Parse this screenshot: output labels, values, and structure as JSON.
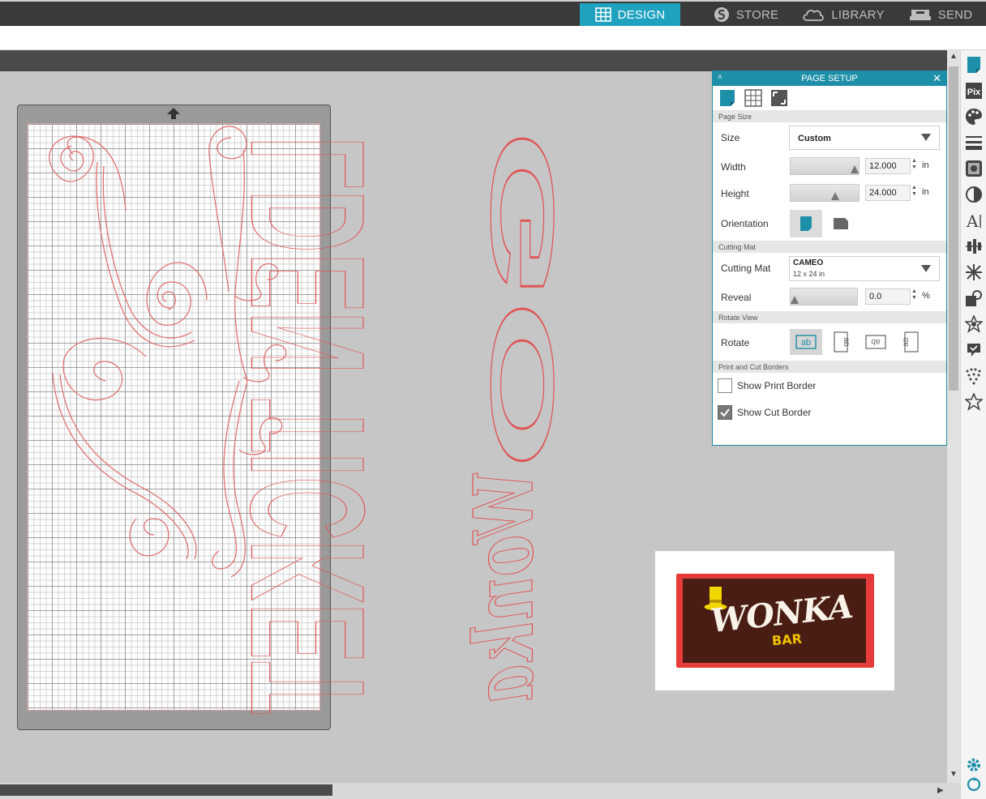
{
  "nav": {
    "tabs": [
      {
        "label": "DESIGN",
        "icon": "grid-icon",
        "active": true
      },
      {
        "label": "STORE",
        "icon": "store-s-icon",
        "active": false
      },
      {
        "label": "LIBRARY",
        "icon": "cloud-icon",
        "active": false
      },
      {
        "label": "SEND",
        "icon": "cutter-icon",
        "active": false
      }
    ]
  },
  "design": {
    "vertical_text_1": "LDEN TICKET",
    "vertical_text_2": "GO",
    "wonka_script": "Wonka"
  },
  "image": {
    "wonka_word": "WONKA",
    "bar_word": "BAR",
    "colors": {
      "wrapper": "#e53b3b",
      "chocolate": "#4a1d14",
      "hat": "#f2d600"
    }
  },
  "panel": {
    "title": "PAGE SETUP",
    "sections": {
      "page_size": "Page Size",
      "cutting_mat": "Cutting Mat",
      "rotate_view": "Rotate View",
      "print_cut_borders": "Print and Cut Borders"
    },
    "size": {
      "label": "Size",
      "value": "Custom"
    },
    "width": {
      "label": "Width",
      "value": "12.000",
      "unit": "in"
    },
    "height": {
      "label": "Height",
      "value": "24.000",
      "unit": "in"
    },
    "orientation": {
      "label": "Orientation"
    },
    "mat": {
      "label": "Cutting Mat",
      "value": "CAMEO",
      "sub": "12 x 24 in"
    },
    "reveal": {
      "label": "Reveal",
      "value": "0.0",
      "unit": "%"
    },
    "rotate": {
      "label": "Rotate",
      "glyph": "ab"
    },
    "show_print_border": {
      "label": "Show Print Border",
      "checked": false
    },
    "show_cut_border": {
      "label": "Show Cut Border",
      "checked": true
    }
  },
  "accent": "#1fa2bf"
}
